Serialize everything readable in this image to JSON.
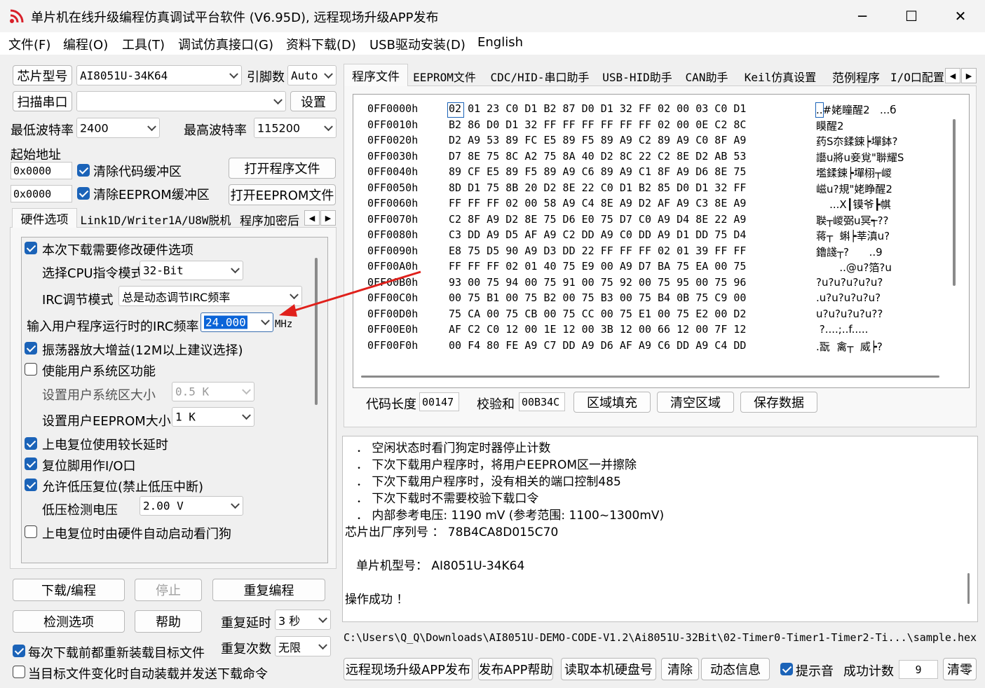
{
  "window": {
    "title": "单片机在线升级编程仿真调试平台软件 (V6.95D), 远程现场升级APP发布",
    "min": "─",
    "max": "☐",
    "close": "✕"
  },
  "menu": [
    "文件(F)",
    "编程(O)",
    "工具(T)",
    "调试仿真接口(G)",
    "资料下载(D)",
    "USB驱动安装(D)",
    "English"
  ],
  "left": {
    "chip_btn": "芯片型号",
    "chip_value": "AI8051U-34K64",
    "pins_label": "引脚数",
    "pins_value": "Auto",
    "scan_btn": "扫描串口",
    "port_value": "",
    "settings_btn": "设置",
    "min_baud_label": "最低波特率",
    "min_baud": "2400",
    "max_baud_label": "最高波特率",
    "max_baud": "115200",
    "start_addr_label": "起始地址",
    "addr1": "0x0000",
    "addr2": "0x0000",
    "clear_code": "清除代码缓冲区",
    "clear_eeprom": "清除EEPROM缓冲区",
    "open_prog_btn": "打开程序文件",
    "open_eeprom_btn": "打开EEPROM文件",
    "tabs": [
      "硬件选项",
      "Link1D/Writer1A/U8W脱机",
      "程序加密后"
    ],
    "opt_modify": "本次下载需要修改硬件选项",
    "cpu_mode_label": "选择CPU指令模式",
    "cpu_mode": "32-Bit",
    "irc_mode_label": "IRC调节模式",
    "irc_mode": "总是动态调节IRC频率",
    "irc_freq_label": "输入用户程序运行时的IRC频率",
    "irc_freq": "24.000",
    "irc_unit": "MHz",
    "osc_gain": "振荡器放大增益(12M以上建议选择)",
    "user_sys": "使能用户系统区功能",
    "sys_size_label": "设置用户系统区大小",
    "sys_size": "0.5  K",
    "eeprom_size_label": "设置用户EEPROM大小",
    "eeprom_size": "1    K",
    "long_reset": "上电复位使用较长延时",
    "reset_io": "复位脚用作I/O口",
    "lvd_reset": "允许低压复位(禁止低压中断)",
    "lvd_label": "低压检测电压",
    "lvd_value": "2.00 V",
    "wdt_auto": "上电复位时由硬件自动启动看门狗",
    "download_btn": "下载/编程",
    "stop_btn": "停止",
    "repeat_btn": "重复编程",
    "check_btn": "检测选项",
    "help_btn": "帮助",
    "repeat_delay_label": "重复延时",
    "repeat_delay": "3 秒",
    "repeat_count_label": "重复次数",
    "repeat_count": "无限",
    "reload_before": "每次下载前都重新装载目标文件",
    "auto_reload": "当目标文件变化时自动装载并发送下载命令"
  },
  "right": {
    "tabs": [
      "程序文件",
      "EEPROM文件",
      "CDC/HID-串口助手",
      "USB-HID助手",
      "CAN助手",
      "Keil仿真设置",
      "范例程序",
      "I/O口配置"
    ],
    "hex": [
      {
        "addr": "0FF0000h",
        "bytes": "02 01 23 C0 D1 B2 87 D0 D1 32 FF 02 00 03 C0 D1",
        "ascii": "..#姥瞳醒2   ...б"
      },
      {
        "addr": "0FF0010h",
        "bytes": "B2 86 D0 D1 32 FF FF FF FF FF FF 02 00 0E C2 8C",
        "ascii": "瞙醒2"
      },
      {
        "addr": "0FF0020h",
        "bytes": "D2 A9 53 89 FC E5 89 F5 89 A9 C2 89 A9 C0 8F A9",
        "ascii": "药S夵鍒鋉┝墠鉢?"
      },
      {
        "addr": "0FF0030h",
        "bytes": "D7 8E 75 8C A2 75 8A 40 D2 8C 22 C2 8E D2 AB 53",
        "ascii": "讛u將u妾覍\"聨耀S"
      },
      {
        "addr": "0FF0040h",
        "bytes": "89 CF E5 89 F5 89 A9 C6 89 A9 C1 8F A9 D6 8E 75",
        "ascii": "壏鍒鋉┝墠栩┬嵕"
      },
      {
        "addr": "0FF0050h",
        "bytes": "8D D1 75 8B 20 D2 8E 22 C0 D1 B2 85 D0 D1 32 FF",
        "ascii": "嵫u?規\"姥睁醒2"
      },
      {
        "addr": "0FF0060h",
        "bytes": "FF FF FF 02 00 58 A9 C4 8E A9 D2 AF A9 C3 8E A9",
        "ascii": "    ...X┃镆爷┣帺"
      },
      {
        "addr": "0FF0070h",
        "bytes": "C2 8F A9 D2 8E 75 D6 E0 75 D7 C0 A9 D4 8E 22 A9",
        "ascii": "聫┬嵕弼u冥┭??"
      },
      {
        "addr": "0FF0080h",
        "bytes": "C3 DD A9 D5 AF A9 C2 DD A9 C0 DD A9 D1 DD 75 D4",
        "ascii": "蒋┬  蝌┝莘滇u?"
      },
      {
        "addr": "0FF0090h",
        "bytes": "E8 75 D5 90 A9 D3 DD 22 FF FF FF 02 01 39 FF FF",
        "ascii": "鑥諓┬?      ..9"
      },
      {
        "addr": "0FF00A0h",
        "bytes": "FF FF FF 02 01 40 75 E9 00 A9 D7 BA 75 EA 00 75",
        "ascii": "       ..@u?箔?u"
      },
      {
        "addr": "0FF00B0h",
        "bytes": "93 00 75 94 00 75 91 00 75 92 00 75 95 00 75 96",
        "ascii": "?u?u?u?u?u?"
      },
      {
        "addr": "0FF00C0h",
        "bytes": "00 75 B1 00 75 B2 00 75 B3 00 75 B4 0B 75 C9 00",
        "ascii": ".u?u?u?u?u?"
      },
      {
        "addr": "0FF00D0h",
        "bytes": "75 CA 00 75 CB 00 75 CC 00 75 E1 00 75 E2 00 D2",
        "ascii": "u?u?u?u?u??"
      },
      {
        "addr": "0FF00E0h",
        "bytes": "AF C2 C0 12 00 1E 12 00 3B 12 00 66 12 00 7F 12",
        "ascii": " ?....;..f....."
      },
      {
        "addr": "0FF00F0h",
        "bytes": "00 F4 80 FE A9 C7 DD A9 D6 AF A9 C6 DD A9 C4 DD",
        "ascii": ".翫  禽┬  威┝?"
      }
    ],
    "code_len_label": "代码长度",
    "code_len": "00147",
    "checksum_label": "校验和",
    "checksum": "00B34C",
    "fill_btn": "区域填充",
    "clear_area_btn": "清空区域",
    "save_btn": "保存数据",
    "log": [
      "．  空闲状态时看门狗定时器停止计数",
      "．  下次下载用户程序时，将用户EEPROM区一并擦除",
      "．  下次下载用户程序时，没有相关的端口控制485",
      "．  下次下载时不需要校验下载口令",
      "．  内部参考电压:  1190 mV (参考范围:  1100~1300mV)",
      "芯片出厂序列号 ： 78B4CA8D015C70",
      "单片机型号： AI8051U-34K64",
      "操作成功 ！"
    ],
    "path": "C:\\Users\\Q_Q\\Downloads\\AI8051U-DEMO-CODE-V1.2\\Ai8051U-32Bit\\02-Timer0-Timer1-Timer2-Ti...\\sample.hex",
    "bottom": {
      "remote_btn": "远程现场升级APP发布",
      "app_help_btn": "发布APP帮助",
      "disk_btn": "读取本机硬盘号",
      "clear_btn": "清除",
      "dyn_btn": "动态信息",
      "beep": "提示音",
      "count_label": "成功计数",
      "count": "9",
      "zero_btn": "清零"
    }
  },
  "colors": {
    "accent": "#1b63b8",
    "arrow": "#e0201b",
    "selection": "#0a64d8"
  }
}
